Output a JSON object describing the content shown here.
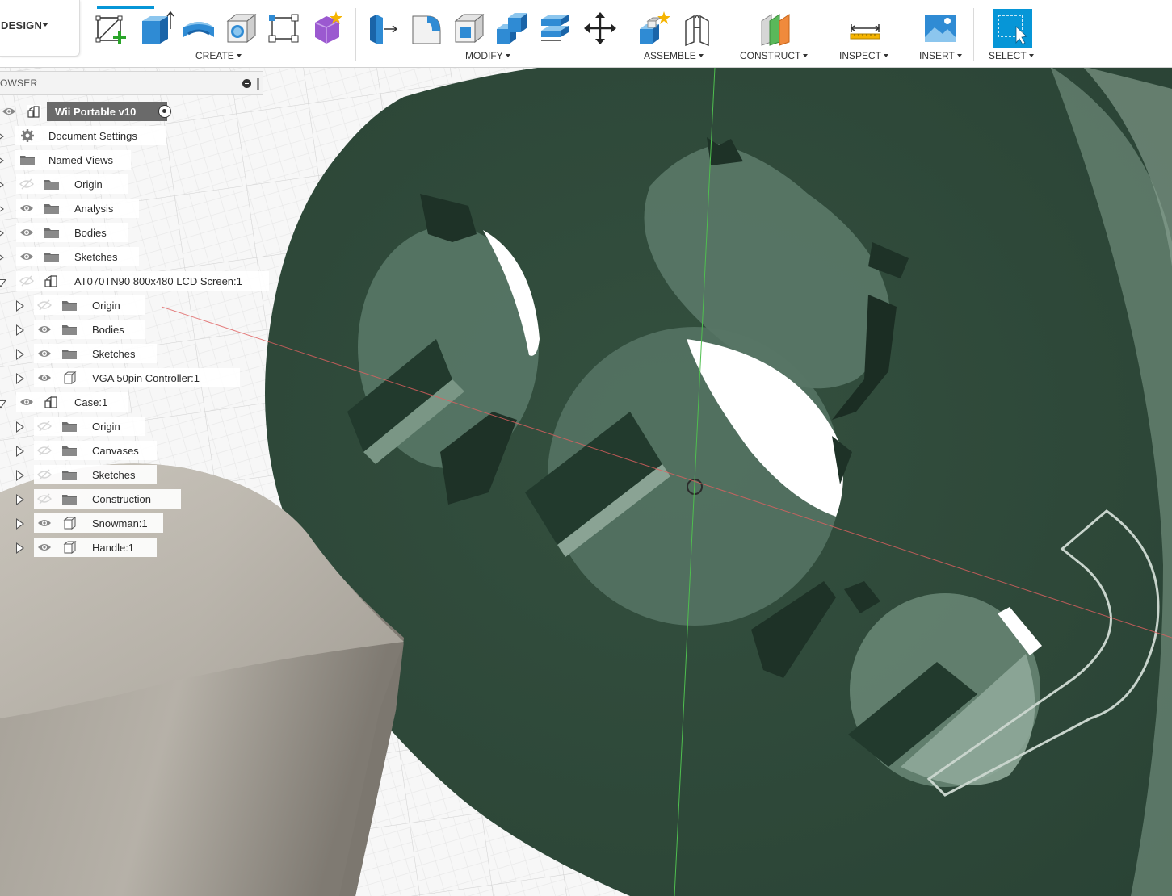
{
  "workspace": {
    "label": "DESIGN"
  },
  "toolbar": {
    "groups": [
      {
        "label": "CREATE"
      },
      {
        "label": "MODIFY"
      },
      {
        "label": "ASSEMBLE"
      },
      {
        "label": "CONSTRUCT"
      },
      {
        "label": "INSPECT"
      },
      {
        "label": "INSERT"
      },
      {
        "label": "SELECT"
      }
    ],
    "tools": {
      "create": [
        "create-sketch-icon",
        "extrude-icon",
        "revolve-icon",
        "hole-icon",
        "pattern-icon",
        "create-form-icon"
      ],
      "modify": [
        "press-pull-icon",
        "fillet-icon",
        "shell-icon",
        "combine-icon",
        "offset-face-icon",
        "move-icon"
      ],
      "assemble": [
        "new-component-icon",
        "joint-icon"
      ],
      "construct": [
        "offset-plane-icon"
      ],
      "inspect": [
        "measure-icon"
      ],
      "insert": [
        "insert-image-icon"
      ],
      "select": [
        "window-select-icon"
      ]
    }
  },
  "browser": {
    "title": "OWSER",
    "items": [
      {
        "label": "Wii Portable v10",
        "level": 0,
        "icon": "assembly-icon",
        "eye": "visible",
        "expanded": null,
        "root": true
      },
      {
        "label": "Document Settings",
        "level": 0,
        "icon": "gear-icon",
        "eye": "none",
        "expanded": false
      },
      {
        "label": "Named Views",
        "level": 0,
        "icon": "folder-icon",
        "eye": "none",
        "expanded": false
      },
      {
        "label": "Origin",
        "level": 0,
        "icon": "folder-icon",
        "eye": "hidden",
        "expanded": false
      },
      {
        "label": "Analysis",
        "level": 0,
        "icon": "folder-icon",
        "eye": "visible",
        "expanded": false
      },
      {
        "label": "Bodies",
        "level": 0,
        "icon": "folder-icon",
        "eye": "visible",
        "expanded": false
      },
      {
        "label": "Sketches",
        "level": 0,
        "icon": "folder-icon",
        "eye": "visible",
        "expanded": false
      },
      {
        "label": "AT070TN90 800x480 LCD Screen:1",
        "level": 0,
        "icon": "component-icon",
        "eye": "hidden",
        "expanded": true
      },
      {
        "label": "Origin",
        "level": 1,
        "icon": "folder-icon",
        "eye": "hidden",
        "expanded": false
      },
      {
        "label": "Bodies",
        "level": 1,
        "icon": "folder-icon",
        "eye": "visible",
        "expanded": false
      },
      {
        "label": "Sketches",
        "level": 1,
        "icon": "folder-icon",
        "eye": "visible",
        "expanded": false
      },
      {
        "label": "VGA 50pin Controller:1",
        "level": 1,
        "icon": "body-icon",
        "eye": "visible",
        "expanded": false
      },
      {
        "label": "Case:1",
        "level": 0,
        "icon": "component-icon",
        "eye": "visible",
        "expanded": true
      },
      {
        "label": "Origin",
        "level": 1,
        "icon": "folder-icon",
        "eye": "hidden",
        "expanded": false
      },
      {
        "label": "Canvases",
        "level": 1,
        "icon": "folder-icon",
        "eye": "hidden",
        "expanded": false
      },
      {
        "label": "Sketches",
        "level": 1,
        "icon": "folder-icon",
        "eye": "hidden",
        "expanded": false
      },
      {
        "label": "Construction",
        "level": 1,
        "icon": "folder-icon",
        "eye": "hidden",
        "expanded": false
      },
      {
        "label": "Snowman:1",
        "level": 1,
        "icon": "body-icon",
        "eye": "visible",
        "expanded": false
      },
      {
        "label": "Handle:1",
        "level": 1,
        "icon": "body-icon",
        "eye": "visible",
        "expanded": false
      }
    ]
  },
  "colors": {
    "accent": "#0696d7",
    "part_green": "#2e4a3c",
    "part_green_light": "#5c7a6a",
    "body_gray": "#9f9a91",
    "grid_line": "#dcdcdc"
  }
}
